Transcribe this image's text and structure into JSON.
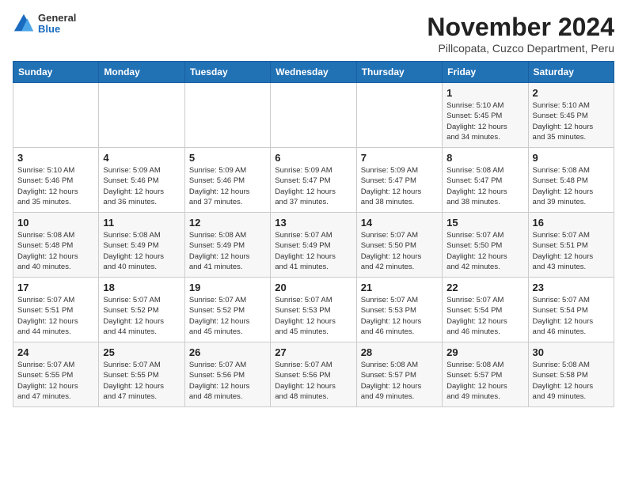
{
  "header": {
    "logo_line1": "General",
    "logo_line2": "Blue",
    "title": "November 2024",
    "subtitle": "Pillcopata, Cuzco Department, Peru"
  },
  "days_of_week": [
    "Sunday",
    "Monday",
    "Tuesday",
    "Wednesday",
    "Thursday",
    "Friday",
    "Saturday"
  ],
  "weeks": [
    [
      {
        "day": "",
        "info": ""
      },
      {
        "day": "",
        "info": ""
      },
      {
        "day": "",
        "info": ""
      },
      {
        "day": "",
        "info": ""
      },
      {
        "day": "",
        "info": ""
      },
      {
        "day": "1",
        "info": "Sunrise: 5:10 AM\nSunset: 5:45 PM\nDaylight: 12 hours\nand 34 minutes."
      },
      {
        "day": "2",
        "info": "Sunrise: 5:10 AM\nSunset: 5:45 PM\nDaylight: 12 hours\nand 35 minutes."
      }
    ],
    [
      {
        "day": "3",
        "info": "Sunrise: 5:10 AM\nSunset: 5:46 PM\nDaylight: 12 hours\nand 35 minutes."
      },
      {
        "day": "4",
        "info": "Sunrise: 5:09 AM\nSunset: 5:46 PM\nDaylight: 12 hours\nand 36 minutes."
      },
      {
        "day": "5",
        "info": "Sunrise: 5:09 AM\nSunset: 5:46 PM\nDaylight: 12 hours\nand 37 minutes."
      },
      {
        "day": "6",
        "info": "Sunrise: 5:09 AM\nSunset: 5:47 PM\nDaylight: 12 hours\nand 37 minutes."
      },
      {
        "day": "7",
        "info": "Sunrise: 5:09 AM\nSunset: 5:47 PM\nDaylight: 12 hours\nand 38 minutes."
      },
      {
        "day": "8",
        "info": "Sunrise: 5:08 AM\nSunset: 5:47 PM\nDaylight: 12 hours\nand 38 minutes."
      },
      {
        "day": "9",
        "info": "Sunrise: 5:08 AM\nSunset: 5:48 PM\nDaylight: 12 hours\nand 39 minutes."
      }
    ],
    [
      {
        "day": "10",
        "info": "Sunrise: 5:08 AM\nSunset: 5:48 PM\nDaylight: 12 hours\nand 40 minutes."
      },
      {
        "day": "11",
        "info": "Sunrise: 5:08 AM\nSunset: 5:49 PM\nDaylight: 12 hours\nand 40 minutes."
      },
      {
        "day": "12",
        "info": "Sunrise: 5:08 AM\nSunset: 5:49 PM\nDaylight: 12 hours\nand 41 minutes."
      },
      {
        "day": "13",
        "info": "Sunrise: 5:07 AM\nSunset: 5:49 PM\nDaylight: 12 hours\nand 41 minutes."
      },
      {
        "day": "14",
        "info": "Sunrise: 5:07 AM\nSunset: 5:50 PM\nDaylight: 12 hours\nand 42 minutes."
      },
      {
        "day": "15",
        "info": "Sunrise: 5:07 AM\nSunset: 5:50 PM\nDaylight: 12 hours\nand 42 minutes."
      },
      {
        "day": "16",
        "info": "Sunrise: 5:07 AM\nSunset: 5:51 PM\nDaylight: 12 hours\nand 43 minutes."
      }
    ],
    [
      {
        "day": "17",
        "info": "Sunrise: 5:07 AM\nSunset: 5:51 PM\nDaylight: 12 hours\nand 44 minutes."
      },
      {
        "day": "18",
        "info": "Sunrise: 5:07 AM\nSunset: 5:52 PM\nDaylight: 12 hours\nand 44 minutes."
      },
      {
        "day": "19",
        "info": "Sunrise: 5:07 AM\nSunset: 5:52 PM\nDaylight: 12 hours\nand 45 minutes."
      },
      {
        "day": "20",
        "info": "Sunrise: 5:07 AM\nSunset: 5:53 PM\nDaylight: 12 hours\nand 45 minutes."
      },
      {
        "day": "21",
        "info": "Sunrise: 5:07 AM\nSunset: 5:53 PM\nDaylight: 12 hours\nand 46 minutes."
      },
      {
        "day": "22",
        "info": "Sunrise: 5:07 AM\nSunset: 5:54 PM\nDaylight: 12 hours\nand 46 minutes."
      },
      {
        "day": "23",
        "info": "Sunrise: 5:07 AM\nSunset: 5:54 PM\nDaylight: 12 hours\nand 46 minutes."
      }
    ],
    [
      {
        "day": "24",
        "info": "Sunrise: 5:07 AM\nSunset: 5:55 PM\nDaylight: 12 hours\nand 47 minutes."
      },
      {
        "day": "25",
        "info": "Sunrise: 5:07 AM\nSunset: 5:55 PM\nDaylight: 12 hours\nand 47 minutes."
      },
      {
        "day": "26",
        "info": "Sunrise: 5:07 AM\nSunset: 5:56 PM\nDaylight: 12 hours\nand 48 minutes."
      },
      {
        "day": "27",
        "info": "Sunrise: 5:07 AM\nSunset: 5:56 PM\nDaylight: 12 hours\nand 48 minutes."
      },
      {
        "day": "28",
        "info": "Sunrise: 5:08 AM\nSunset: 5:57 PM\nDaylight: 12 hours\nand 49 minutes."
      },
      {
        "day": "29",
        "info": "Sunrise: 5:08 AM\nSunset: 5:57 PM\nDaylight: 12 hours\nand 49 minutes."
      },
      {
        "day": "30",
        "info": "Sunrise: 5:08 AM\nSunset: 5:58 PM\nDaylight: 12 hours\nand 49 minutes."
      }
    ]
  ]
}
